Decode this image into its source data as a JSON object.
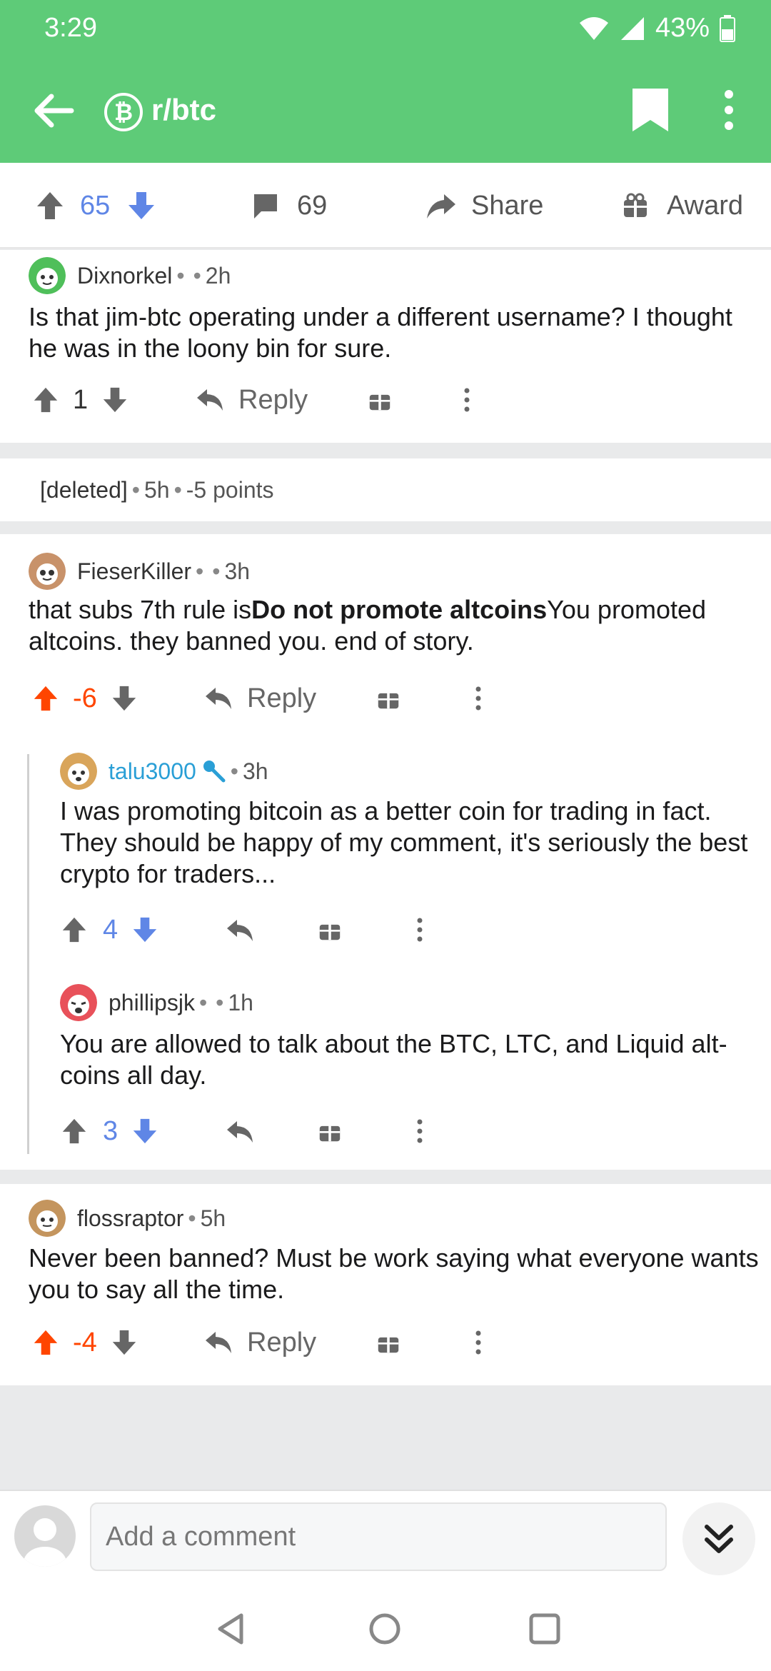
{
  "status_bar": {
    "time": "3:29",
    "battery": "43%"
  },
  "app_bar": {
    "subreddit": "r/btc",
    "sub_icon_glyph": "₿"
  },
  "post_actions": {
    "score": "65",
    "comments": "69",
    "share_label": "Share",
    "award_label": "Award"
  },
  "comments": [
    {
      "author": "Dixnorkel",
      "age": "2h",
      "text": "Is that jim-btc operating under a different username? I thought he was in the loony bin for sure.",
      "score": "1",
      "reply_label": "Reply"
    },
    {
      "deleted_label": "[deleted]",
      "age": "5h",
      "points": "-5 points"
    },
    {
      "author": "FieserKiller",
      "age": "3h",
      "text_before": "that subs 7th rule is",
      "text_bold": "Do not promote altcoins",
      "text_after": "You promoted altcoins. they banned you. end of story.",
      "score": "-6",
      "reply_label": "Reply"
    },
    {
      "author": "talu3000",
      "age": "3h",
      "text": "I was promoting bitcoin as a better coin for trading in fact. They should be happy of my comment, it's seriously the best crypto for traders...",
      "score": "4"
    },
    {
      "author": "phillipsjk",
      "age": "1h",
      "text": "You are allowed to talk about the BTC, LTC, and Liquid alt-coins all day.",
      "score": "3"
    },
    {
      "author": "flossraptor",
      "age": "5h",
      "text": "Never been banned? Must be work saying what everyone wants you to say all the time.",
      "score": "-4",
      "reply_label": "Reply"
    }
  ],
  "comment_bar": {
    "placeholder": "Add a comment"
  },
  "colors": {
    "header": "#5ecb78",
    "upvote": "#ff4500",
    "downvote": "#5f86e6",
    "op_blue": "#2a9fd6"
  }
}
